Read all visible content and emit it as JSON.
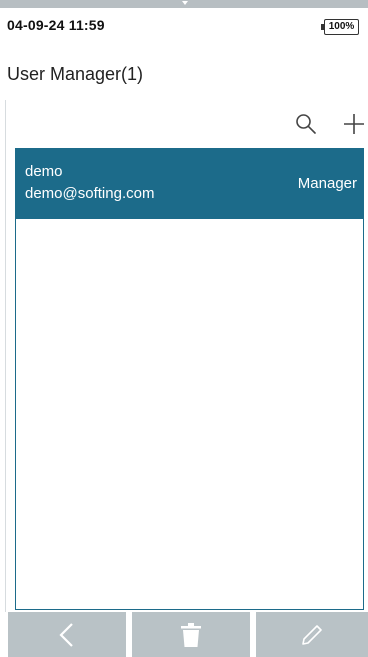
{
  "status_bar": {
    "datetime": "04-09-24 11:59",
    "battery": "100%"
  },
  "header": {
    "title": "User Manager(1)"
  },
  "toolbar": {
    "search_icon": "search-icon",
    "add_icon": "plus-icon"
  },
  "users": [
    {
      "name": "demo",
      "email": "demo@softing.com",
      "role": "Manager"
    }
  ],
  "bottom_nav": {
    "back_icon": "chevron-left-icon",
    "delete_icon": "trash-icon",
    "edit_icon": "pencil-icon"
  },
  "colors": {
    "accent": "#1c6b8a",
    "nav_button": "#b9c2c6",
    "top_strip": "#b7bec2"
  }
}
